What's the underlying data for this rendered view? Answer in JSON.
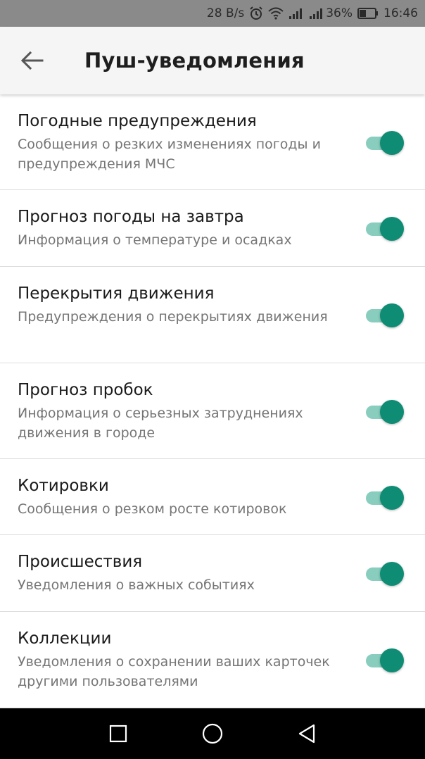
{
  "status_bar": {
    "speed": "28 B/s",
    "battery": "36%",
    "time": "16:46",
    "icons": [
      "alarm-icon",
      "wifi-icon",
      "signal-icon",
      "signal-icon",
      "battery-icon"
    ]
  },
  "header": {
    "back_icon": "arrow-left-icon",
    "title": "Пуш-уведомления"
  },
  "settings": [
    {
      "title": "Погодные предупреждения",
      "subtitle": "Сообщения о резких изменениях погоды и предупреждения МЧС",
      "enabled": true
    },
    {
      "title": "Прогноз погоды на завтра",
      "subtitle": "Информация о температуре и осадках",
      "enabled": true
    },
    {
      "title": "Перекрытия движения",
      "subtitle": "Предупреждения о перекрытиях движения",
      "enabled": true
    },
    {
      "title": "Прогноз пробок",
      "subtitle": "Информация о серьезных затруднениях движения в городе",
      "enabled": true
    },
    {
      "title": "Котировки",
      "subtitle": "Сообщения о резком росте котировок",
      "enabled": true
    },
    {
      "title": "Происшествия",
      "subtitle": "Уведомления о важных событиях",
      "enabled": true
    },
    {
      "title": "Коллекции",
      "subtitle": "Уведомления о сохранении ваших карточек другими пользователями",
      "enabled": true
    }
  ],
  "colors": {
    "accent": "#0e8c74",
    "accent_track": "#88cdbd",
    "status_bar_bg": "#8a8a8a",
    "app_bar_bg": "#f5f5f5"
  },
  "nav_bar": {
    "icons": [
      "recent-apps-icon",
      "home-icon",
      "back-triangle-icon"
    ]
  }
}
